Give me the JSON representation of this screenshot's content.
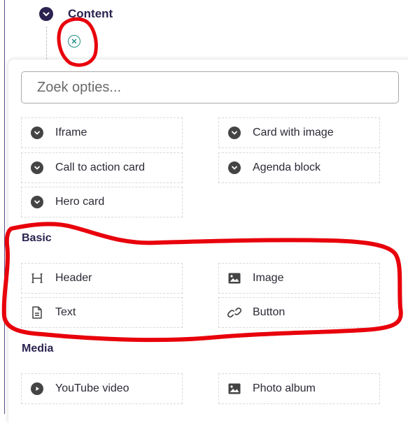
{
  "tree": {
    "content_title": "Content"
  },
  "search": {
    "placeholder": "Zoek opties..."
  },
  "components": [
    {
      "label": "Iframe",
      "icon": "chevron-down-icon"
    },
    {
      "label": "Card with image",
      "icon": "chevron-down-icon"
    },
    {
      "label": "Call to action card",
      "icon": "chevron-down-icon"
    },
    {
      "label": "Agenda block",
      "icon": "chevron-down-icon"
    },
    {
      "label": "Hero card",
      "icon": "chevron-down-icon"
    }
  ],
  "basic": {
    "title": "Basic",
    "items": [
      {
        "label": "Header",
        "icon": "heading-icon"
      },
      {
        "label": "Image",
        "icon": "image-icon"
      },
      {
        "label": "Text",
        "icon": "document-icon"
      },
      {
        "label": "Button",
        "icon": "link-icon"
      }
    ]
  },
  "media": {
    "title": "Media",
    "items": [
      {
        "label": "YouTube video",
        "icon": "play-icon"
      },
      {
        "label": "Photo album",
        "icon": "photo-icon"
      }
    ]
  },
  "colors": {
    "accent": "#2c2350",
    "teal": "#1f8f85",
    "annotation": "#e8000b"
  }
}
